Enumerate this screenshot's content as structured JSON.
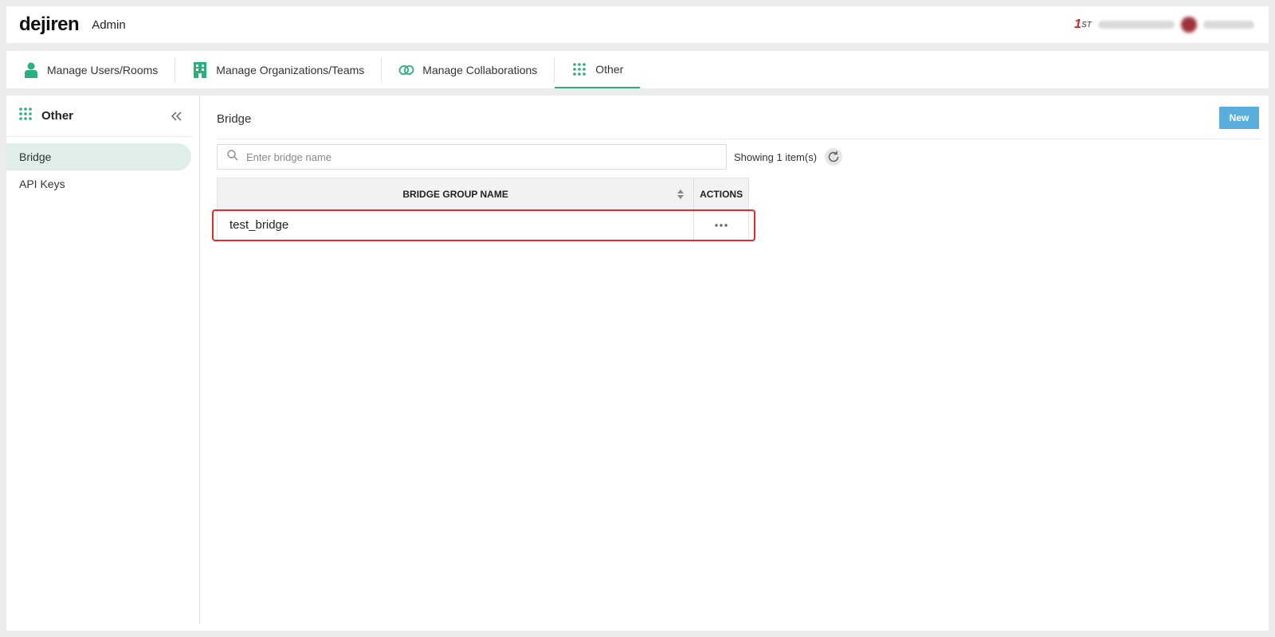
{
  "header": {
    "logo": "dejiren",
    "admin_label": "Admin",
    "brand_mark_number": "1",
    "brand_mark_suffix": "ST"
  },
  "tabs": [
    {
      "label": "Manage Users/Rooms",
      "icon": "user-icon"
    },
    {
      "label": "Manage Organizations/Teams",
      "icon": "building-icon"
    },
    {
      "label": "Manage Collaborations",
      "icon": "link-icon"
    },
    {
      "label": "Other",
      "icon": "grid-icon",
      "active": true
    }
  ],
  "sidebar": {
    "title": "Other",
    "items": [
      {
        "label": "Bridge",
        "active": true
      },
      {
        "label": "API Keys"
      }
    ]
  },
  "main": {
    "title": "Bridge",
    "new_button": "New",
    "search_placeholder": "Enter bridge name",
    "showing_text": "Showing 1 item(s)",
    "table": {
      "columns": [
        "BRIDGE GROUP NAME",
        "ACTIONS"
      ],
      "rows": [
        {
          "name": "test_bridge",
          "actions": "•••"
        }
      ]
    }
  },
  "colors": {
    "accent": "#2ab07b",
    "new_button": "#5aaede",
    "highlight": "#e32b2b",
    "sidebar_active": "#dfeee8"
  }
}
